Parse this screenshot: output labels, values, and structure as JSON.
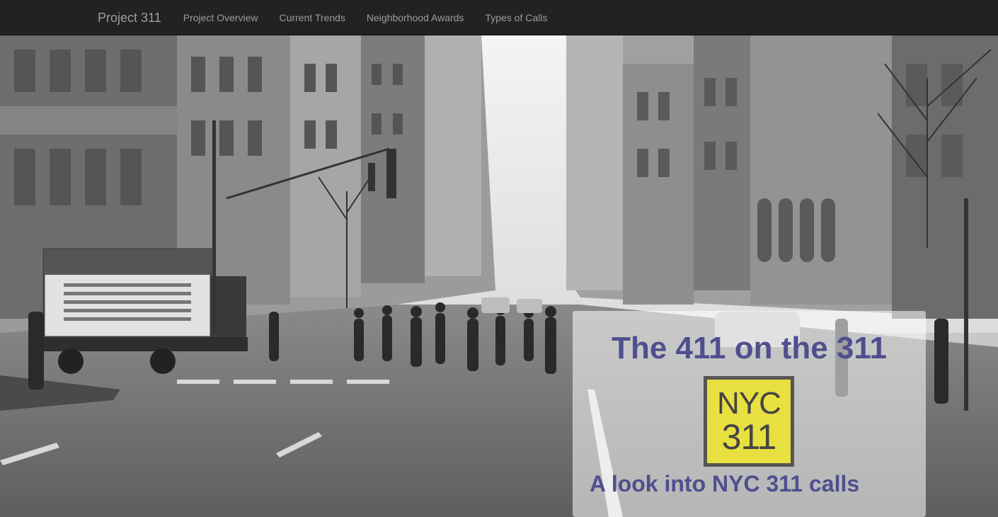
{
  "navbar": {
    "brand": "Project 311",
    "links": [
      {
        "label": "Project Overview"
      },
      {
        "label": "Current Trends"
      },
      {
        "label": "Neighborhood Awards"
      },
      {
        "label": "Types of Calls"
      }
    ]
  },
  "hero": {
    "title": "The 411 on the 311",
    "logo": {
      "line1": "NYC",
      "line2": "311"
    },
    "subtitle": "A look into NYC 311 calls"
  },
  "colors": {
    "navbar_bg": "#222222",
    "nav_text": "#9d9d9d",
    "accent_text": "#4f4f8f",
    "logo_yellow": "#e8e040"
  }
}
